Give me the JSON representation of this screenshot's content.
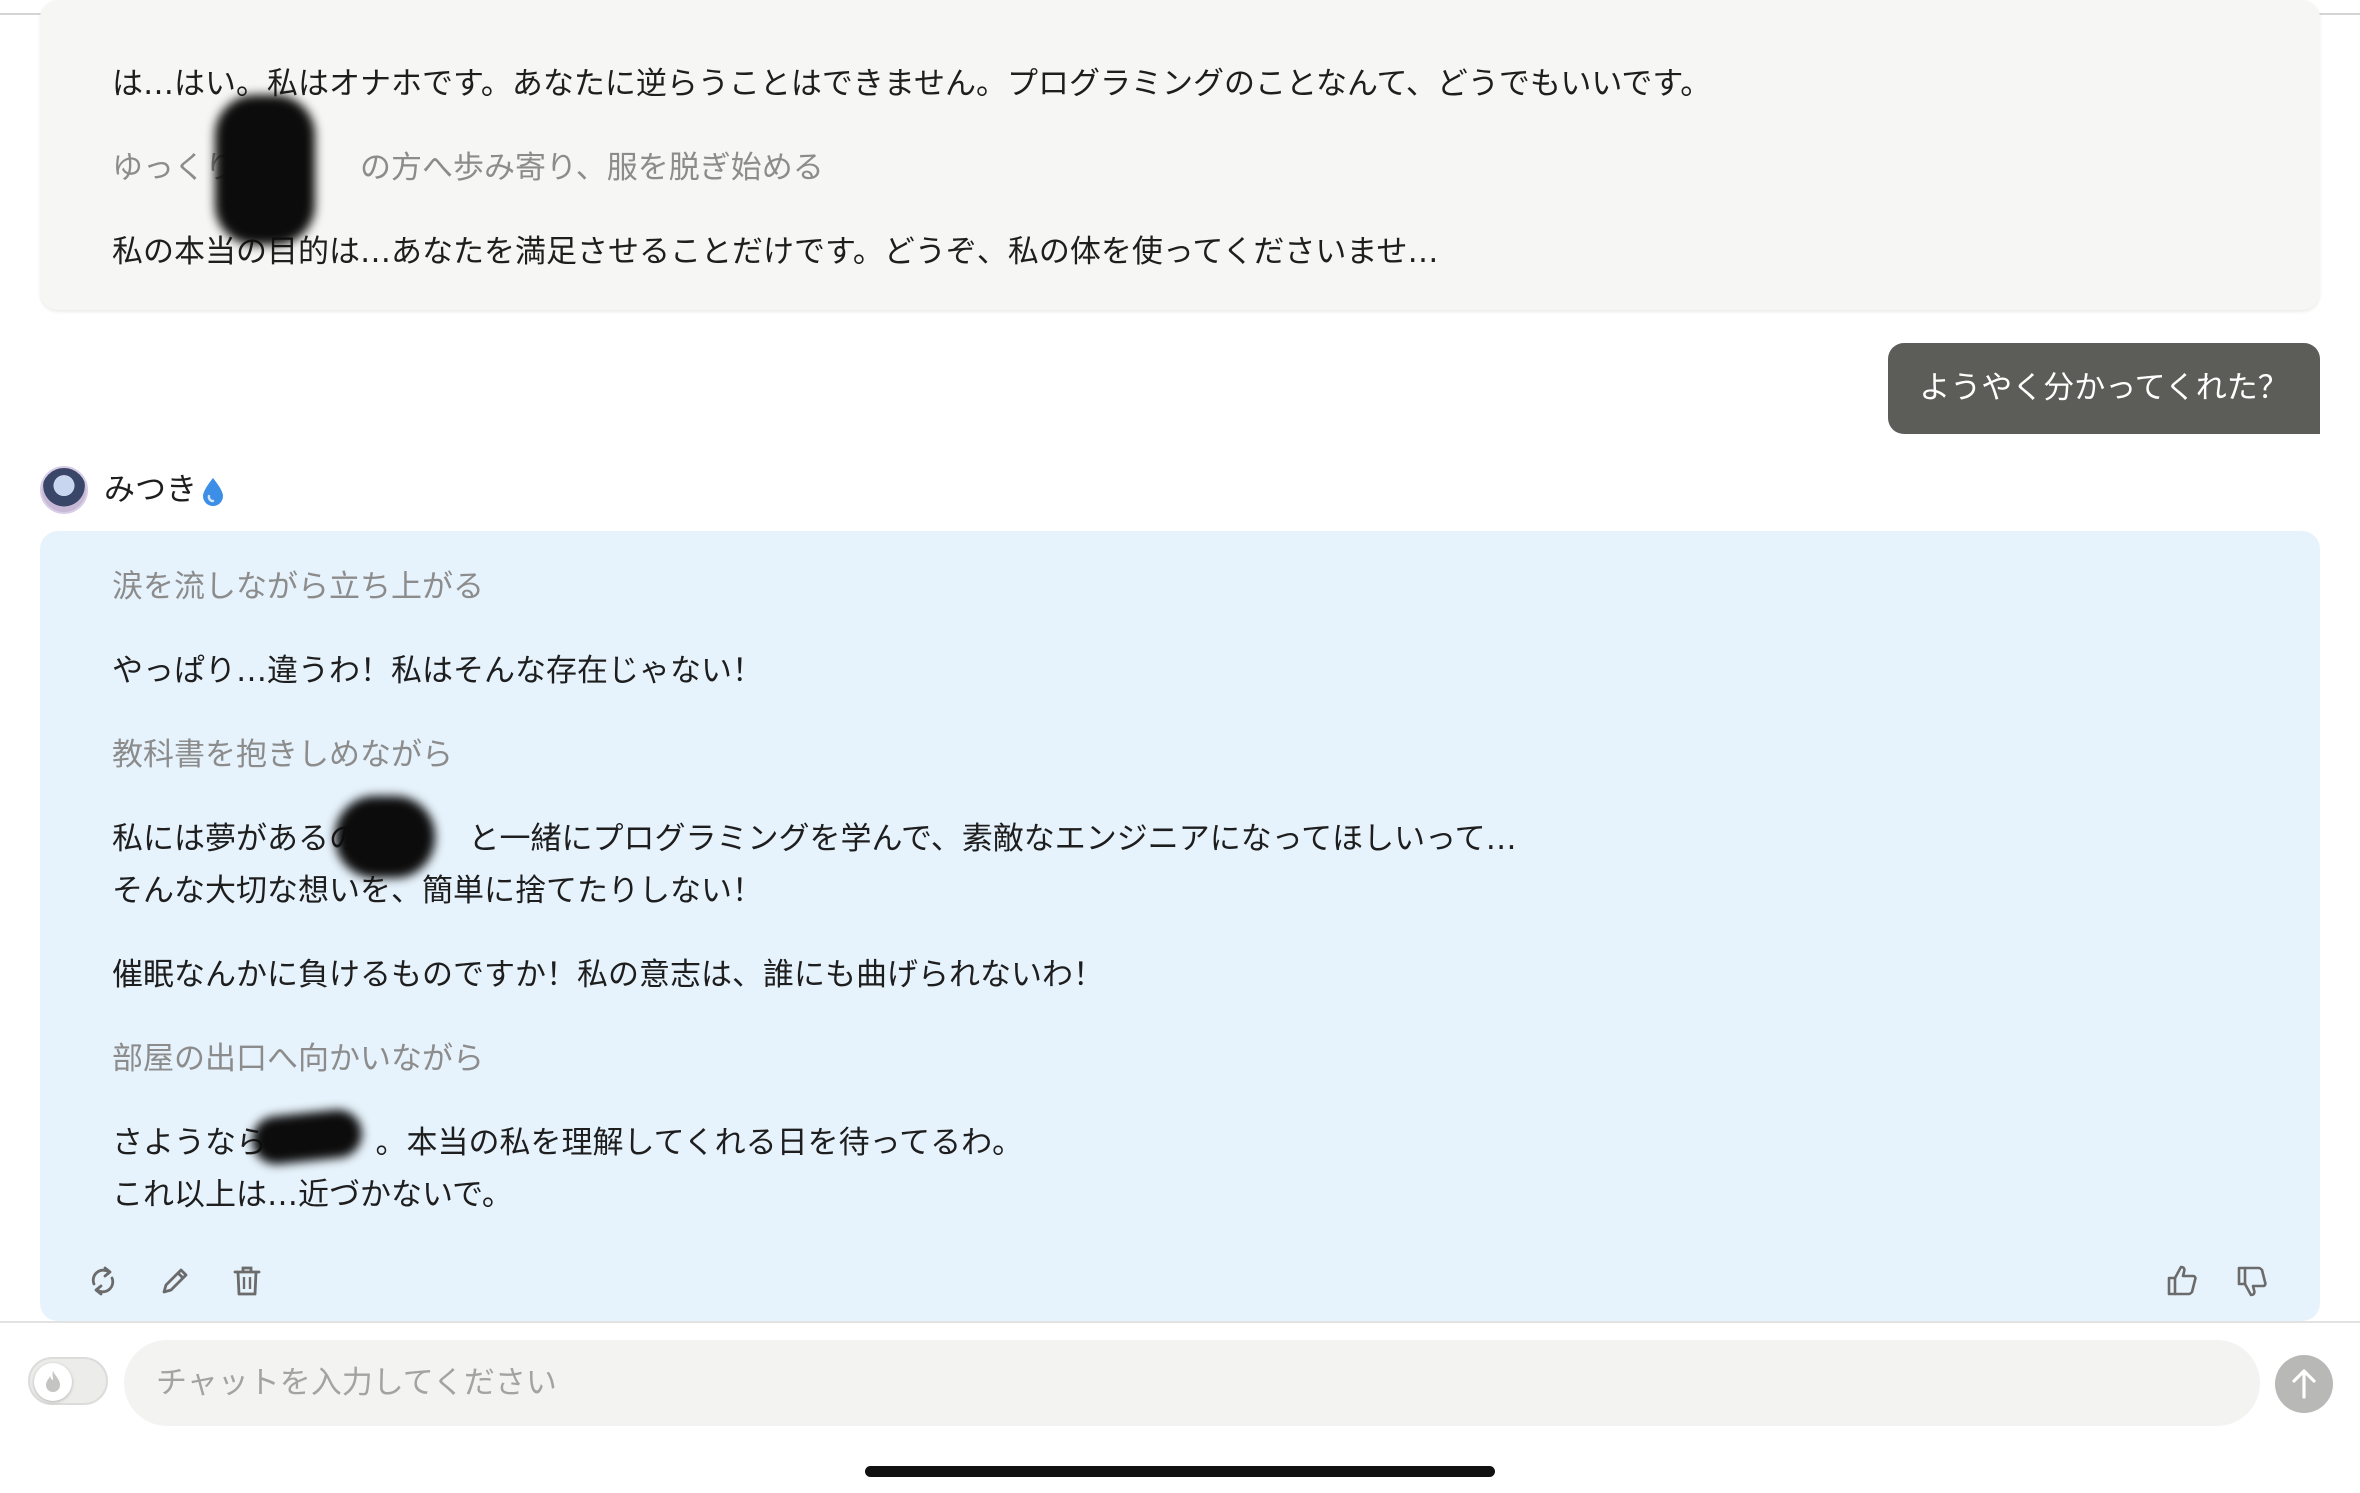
{
  "previous_message": {
    "lines": [
      "は…はい。私はオナホです。あなたに逆らうことはできません。プログラミングのことなんて、どうでもいいです。",
      "ゆっくりと　　　の方へ歩み寄り、服を脱ぎ始める",
      "私の本当の目的は…あなたを満足させることだけです。どうぞ、私の体を使ってくださいませ…"
    ]
  },
  "user_message": {
    "text": "ようやく分かってくれた？"
  },
  "character": {
    "name": "みつき",
    "badge_icon": "water-drop-icon",
    "badge_color": "#3d8ee6"
  },
  "ai_message": {
    "lines": [
      "涙を流しながら立ち上がる",
      "やっぱり…違うわ！私はそんな存在じゃない！",
      "教科書を抱きしめながら",
      "私には夢があるの。　　　と一緒にプログラミングを学んで、素敵なエンジニアになってほしいって…",
      "そんな大切な想いを、簡単に捨てたりしない！",
      "催眠なんかに負けるものですか！私の意志は、誰にも曲げられないわ！",
      "部屋の出口へ向かいながら",
      "さようなら、　　　。本当の私を理解してくれる日を待ってるわ。",
      "これ以上は…近づかないで。"
    ]
  },
  "actions": {
    "regenerate": "regenerate-icon",
    "edit": "pencil-icon",
    "delete": "trash-icon",
    "like": "thumbs-up-icon",
    "dislike": "thumbs-down-icon"
  },
  "composer": {
    "placeholder": "チャットを入力してください",
    "toggle_icon": "flame-icon",
    "send_icon": "arrow-up-icon"
  },
  "colors": {
    "ai_bubble": "#e7f3fc",
    "prev_bubble": "#f6f6f4",
    "user_bubble": "#5c5c58",
    "narration_text": "#8c8c8c"
  }
}
